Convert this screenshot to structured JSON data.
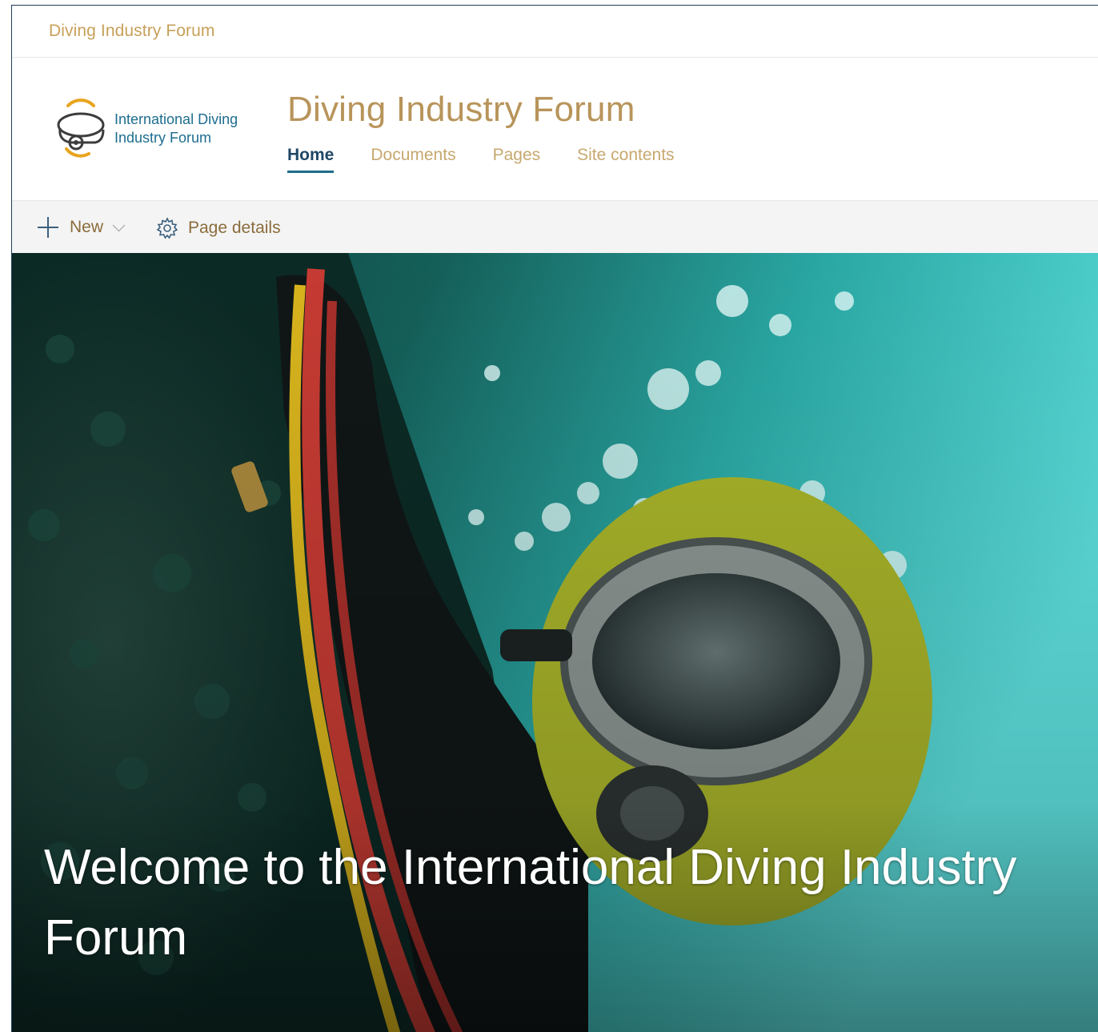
{
  "suite_bar": {
    "site_link": "Diving Industry Forum"
  },
  "header": {
    "logo_text": "International Diving Industry Forum",
    "site_title": "Diving Industry Forum",
    "nav": [
      {
        "label": "Home",
        "active": true
      },
      {
        "label": "Documents",
        "active": false
      },
      {
        "label": "Pages",
        "active": false
      },
      {
        "label": "Site contents",
        "active": false
      }
    ]
  },
  "command_bar": {
    "new_label": "New",
    "page_details_label": "Page details",
    "icons": [
      "plus-icon",
      "chevron-down-icon",
      "gear-icon"
    ]
  },
  "hero": {
    "title": "Welcome to the International Diving Industry Forum",
    "image_description_icon": "diver-hero-image"
  },
  "colors": {
    "gold": "#c7a15a",
    "navy": "#1f4766",
    "teal_accent": "#1f6b8a",
    "cmd_bar_bg": "#f4f4f4"
  }
}
